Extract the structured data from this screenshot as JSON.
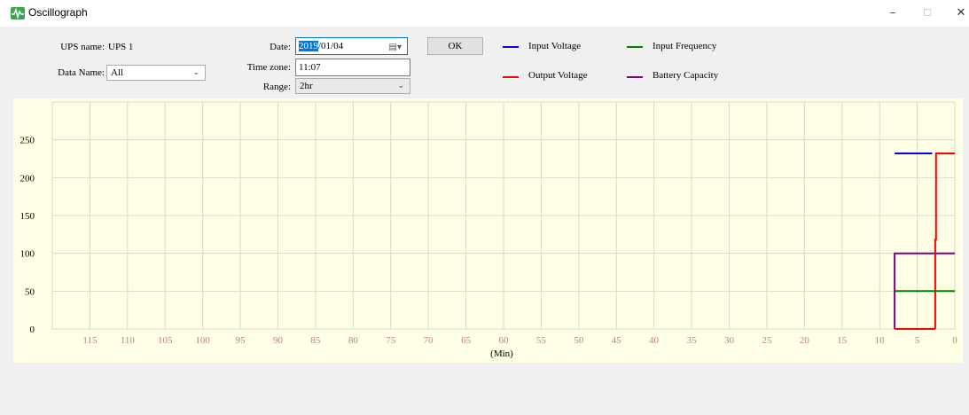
{
  "window": {
    "title": "Oscillograph",
    "minimize": "–",
    "maximize": "☐",
    "close": "✕"
  },
  "form": {
    "ups_name_label": "UPS name:",
    "ups_name_value": "UPS 1",
    "data_name_label": "Data Name:",
    "data_name_value": "All",
    "date_label": "Date:",
    "date_year": "2019",
    "date_rest": "/01/04",
    "timezone_label": "Time zone:",
    "timezone_value": "11:07",
    "range_label": "Range:",
    "range_value": "2hr",
    "ok_label": "OK"
  },
  "legend": [
    {
      "label": "Input Voltage",
      "color": "#0000ff"
    },
    {
      "label": "Input Frequency",
      "color": "#008000"
    },
    {
      "label": "Output Voltage",
      "color": "#ff0000"
    },
    {
      "label": "Battery Capacity",
      "color": "#800080"
    }
  ],
  "chart_data": {
    "type": "line",
    "xlabel": "(Min)",
    "ylabel": "",
    "xlim": [
      120,
      0
    ],
    "ylim": [
      0,
      300
    ],
    "x_ticks": [
      "115",
      "110",
      "105",
      "100",
      "95",
      "90",
      "85",
      "80",
      "75",
      "70",
      "65",
      "60",
      "55",
      "50",
      "45",
      "40",
      "35",
      "30",
      "25",
      "20",
      "15",
      "10",
      "5",
      "0"
    ],
    "y_ticks": [
      "0",
      "50",
      "100",
      "150",
      "200",
      "250"
    ],
    "grid": true,
    "series": [
      {
        "name": "Input Voltage",
        "color": "#0000ff",
        "points": [
          [
            8,
            232
          ],
          [
            3,
            232
          ]
        ]
      },
      {
        "name": "Output Voltage",
        "color": "#ff0000",
        "points": [
          [
            2.6,
            0
          ],
          [
            2.6,
            118
          ],
          [
            2.5,
            118
          ],
          [
            2.5,
            232
          ],
          [
            0,
            232
          ]
        ]
      },
      {
        "name": "Input Frequency",
        "color": "#008000",
        "points": [
          [
            8,
            50
          ],
          [
            0,
            50
          ]
        ]
      },
      {
        "name": "Battery Capacity",
        "color": "#800080",
        "points": [
          [
            8,
            0
          ],
          [
            8,
            100
          ],
          [
            0,
            100
          ]
        ]
      },
      {
        "name": "Output Voltage",
        "color": "#ff0000",
        "points": [
          [
            8,
            0
          ],
          [
            2.6,
            0
          ]
        ]
      }
    ]
  }
}
